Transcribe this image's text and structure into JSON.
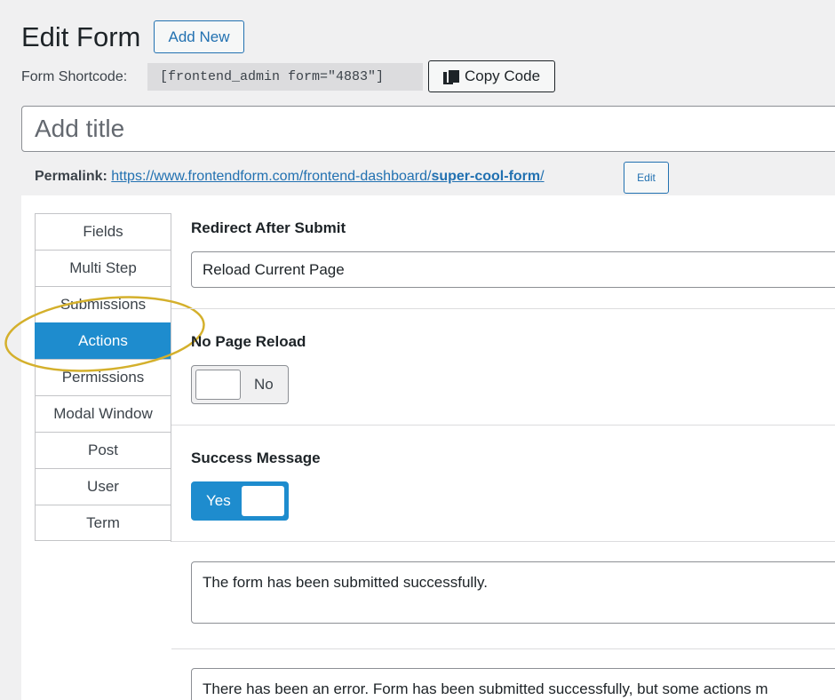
{
  "header": {
    "title": "Edit Form",
    "add_new_label": "Add New"
  },
  "shortcode": {
    "label": "Form Shortcode:",
    "value": "[frontend_admin form=\"4883\"]",
    "copy_label": "Copy Code"
  },
  "title_field": {
    "placeholder": "Add title",
    "value": ""
  },
  "permalink": {
    "label": "Permalink:",
    "base": "https://www.frontendform.com/frontend-dashboard/",
    "slug": "super-cool-form",
    "trailing": "/",
    "edit_label": "Edit"
  },
  "tabs": [
    {
      "label": "Fields"
    },
    {
      "label": "Multi Step"
    },
    {
      "label": "Submissions"
    },
    {
      "label": "Actions",
      "active": true
    },
    {
      "label": "Permissions"
    },
    {
      "label": "Modal Window"
    },
    {
      "label": "Post"
    },
    {
      "label": "User"
    },
    {
      "label": "Term"
    }
  ],
  "settings": {
    "redirect": {
      "label": "Redirect After Submit",
      "value": "Reload Current Page"
    },
    "no_page_reload": {
      "label": "No Page Reload",
      "state": "No"
    },
    "success_message": {
      "label": "Success Message",
      "state": "Yes",
      "text": "The form has been submitted successfully."
    },
    "error_message": {
      "text": "There has been an error. Form has been submitted successfully, but some actions m"
    }
  },
  "colors": {
    "accent": "#1e8cce",
    "link": "#2271b1",
    "highlight_ring": "#d4b02c"
  }
}
